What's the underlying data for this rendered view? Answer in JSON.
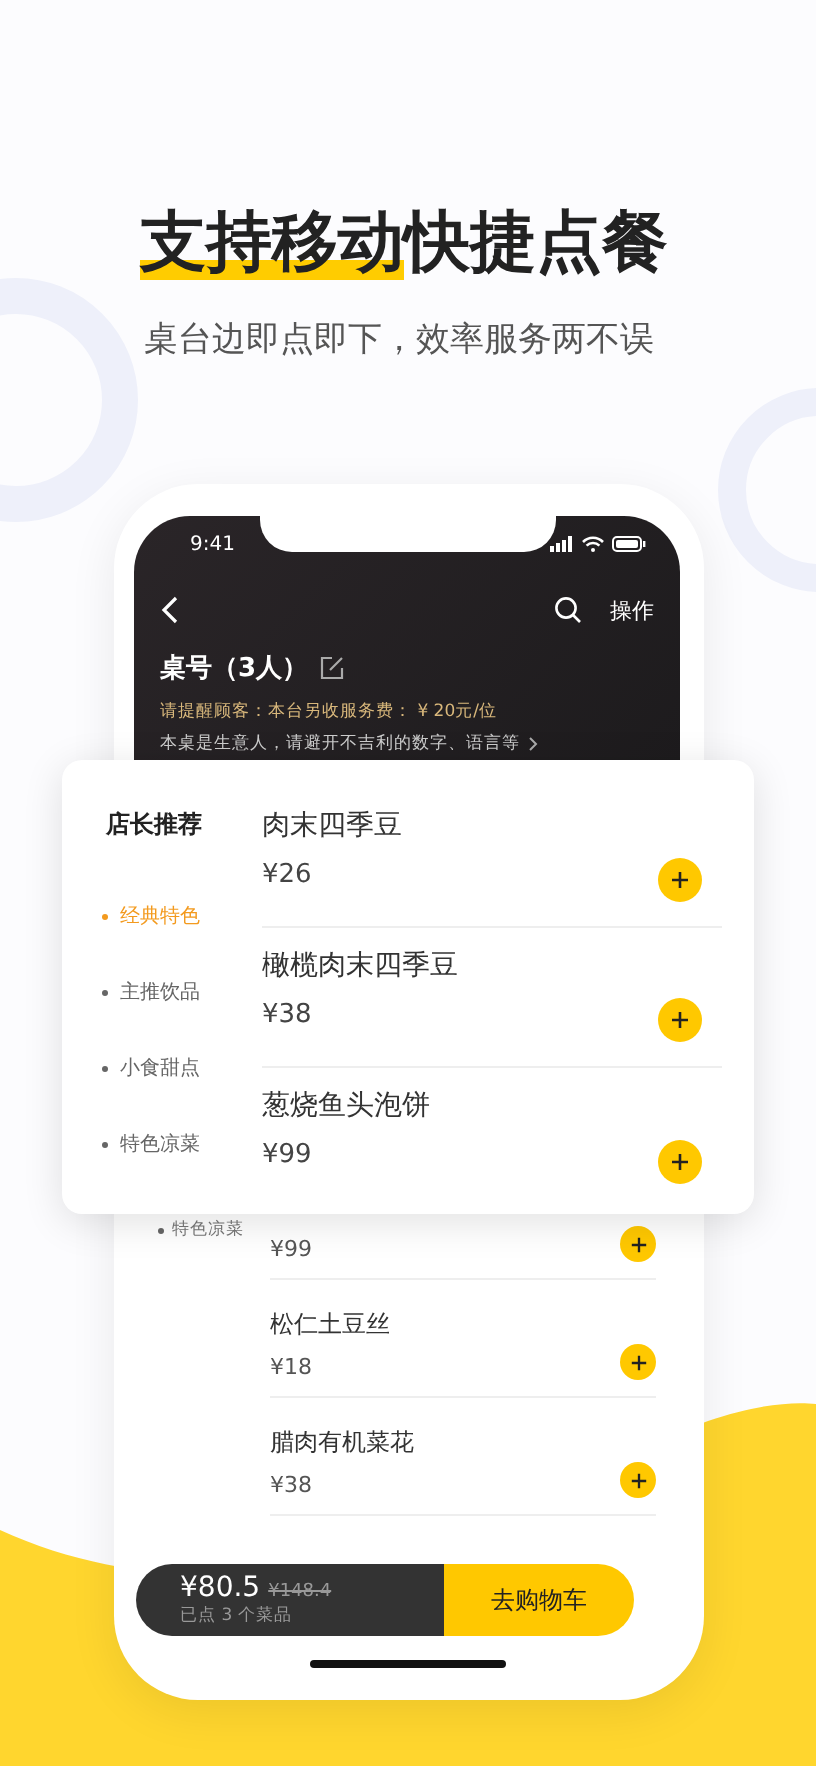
{
  "headline": {
    "highlighted": "支持移动",
    "rest": "快捷点餐"
  },
  "subtitle": "桌台边即点即下，效率服务两不误",
  "phone": {
    "status_bar": {
      "time": "9:41"
    },
    "nav": {
      "action": "操作"
    },
    "table": {
      "title": "桌号（3人）",
      "notice": "请提醒顾客：本台另收服务费： ¥ 20元/位",
      "remark": "本桌是生意人，请避开不吉利的数字、语言等"
    },
    "list_sidebar_item": "特色凉菜",
    "dishes": [
      {
        "price": "¥99"
      },
      {
        "name": "松仁土豆丝",
        "price": "¥18"
      },
      {
        "name": "腊肉有机菜花",
        "price": "¥38"
      }
    ],
    "cart": {
      "total": "¥80.5",
      "original": "¥148.4",
      "count": "已点 3 个菜品",
      "button": "去购物车"
    }
  },
  "popup": {
    "section_title": "店长推荐",
    "categories": [
      {
        "label": "经典特色",
        "selected": true
      },
      {
        "label": "主推饮品",
        "selected": false
      },
      {
        "label": "小食甜点",
        "selected": false
      },
      {
        "label": "特色凉菜",
        "selected": false
      }
    ],
    "items": [
      {
        "name": "肉末四季豆",
        "price": "¥26"
      },
      {
        "name": "橄榄肉末四季豆",
        "price": "¥38"
      },
      {
        "name": "葱烧鱼头泡饼",
        "price": "¥99"
      }
    ]
  }
}
